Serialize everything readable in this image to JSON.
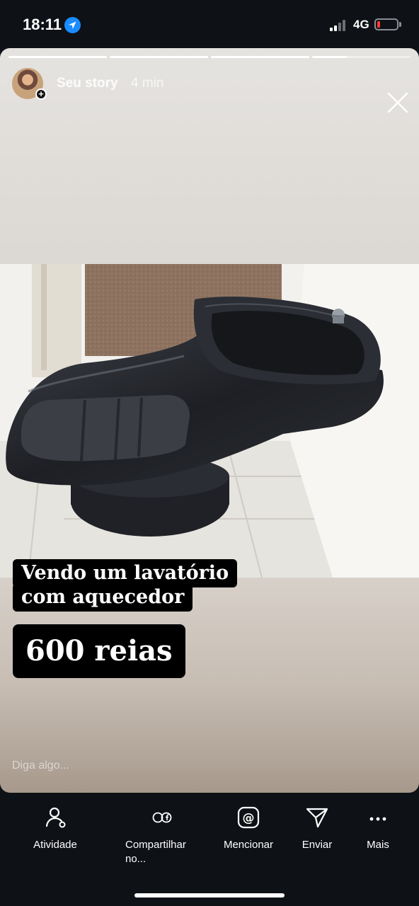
{
  "status_bar": {
    "time": "18:11",
    "network": "4G",
    "battery_level": 0.08,
    "signal_bars_active": 2
  },
  "story": {
    "owner": "Seu story",
    "time_ago": "4 min",
    "progress_segments": [
      1,
      1,
      1,
      0.35
    ],
    "caption_lines": [
      "Vendo um lavatório",
      "com aquecedor"
    ],
    "price": "600 reias",
    "reply_placeholder": "Diga algo..."
  },
  "actions": [
    {
      "label": "Atividade",
      "icon": "activity-icon"
    },
    {
      "label": "Compartilhar no...",
      "icon": "whatsapp-facebook-icon"
    },
    {
      "label": "Mencionar",
      "icon": "mention-icon"
    },
    {
      "label": "Enviar",
      "icon": "send-icon"
    },
    {
      "label": "Mais",
      "icon": "more-icon"
    }
  ],
  "colors": {
    "background": "#0e1116",
    "location_blue": "#1a8cff",
    "battery_low": "#ff3b30",
    "caption_bg": "#000000"
  }
}
